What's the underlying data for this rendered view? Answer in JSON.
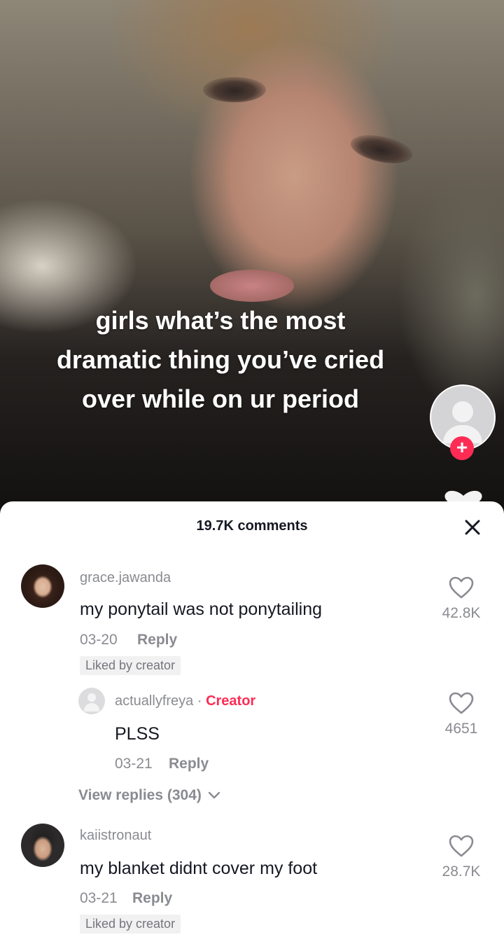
{
  "video": {
    "caption": "girls what’s the most\ndramatic thing you’ve cried\nover while on ur period",
    "follow_symbol": "+"
  },
  "comments_sheet": {
    "title": "19.7K comments",
    "close_icon": "close-icon",
    "comments": [
      {
        "username": "grace.jawanda",
        "text": "my ponytail was not ponytailing",
        "date": "03-20",
        "reply_label": "Reply",
        "badge": "Liked by creator",
        "likes": "42.8K"
      },
      {
        "username": "actuallyfreya",
        "separator": "·",
        "creator_tag": "Creator",
        "text": "PLSS",
        "date": "03-21",
        "reply_label": "Reply",
        "likes": "4651"
      },
      {
        "username": "kaiistronaut",
        "text": "my blanket didnt cover my foot",
        "date": "03-21",
        "reply_label": "Reply",
        "badge": "Liked by creator",
        "likes": "28.7K"
      }
    ],
    "view_replies": "View replies (304)"
  },
  "colors": {
    "accent": "#fe2c55",
    "muted_text": "#8a8b91",
    "primary_text": "#161823"
  }
}
